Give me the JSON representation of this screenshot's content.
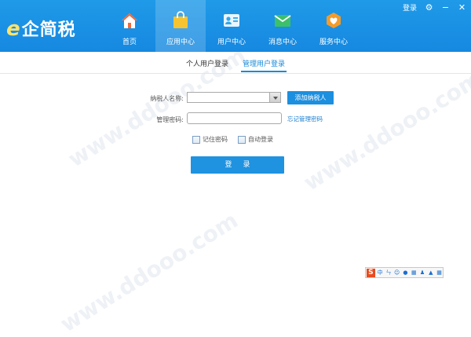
{
  "app": {
    "logo_e": "e",
    "logo_text": "企简税",
    "login_link": "登录"
  },
  "nav": [
    {
      "label": "首页",
      "icon": "home-icon",
      "active": false
    },
    {
      "label": "应用中心",
      "icon": "shopping-bag-icon",
      "active": true
    },
    {
      "label": "用户中心",
      "icon": "user-card-icon",
      "active": false
    },
    {
      "label": "消息中心",
      "icon": "envelope-icon",
      "active": false
    },
    {
      "label": "服务中心",
      "icon": "service-heart-icon",
      "active": false
    }
  ],
  "tabs": [
    {
      "label": "个人用户登录",
      "active": false
    },
    {
      "label": "管理用户登录",
      "active": true
    }
  ],
  "form": {
    "taxpayer_label": "纳税人名称:",
    "taxpayer_value": "",
    "add_taxpayer_button": "添加纳税人",
    "password_label": "管理密码:",
    "password_value": "",
    "forgot_password": "忘记管理密码",
    "remember_password": "记住密码",
    "auto_login": "自动登录",
    "login_button": "登录"
  },
  "ime_toolbar": {
    "brand": "S",
    "items": [
      "中",
      "ㄣ",
      "☺",
      "●",
      "▦",
      "♟",
      "▲",
      "▦"
    ]
  },
  "colors": {
    "header": "#1f9ae8",
    "accent": "#1c8fdf"
  }
}
